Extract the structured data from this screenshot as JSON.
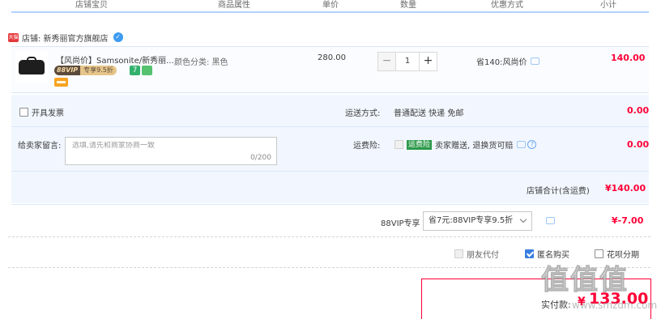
{
  "header": {
    "col_shop": "店铺宝贝",
    "col_props": "商品属性",
    "col_price": "单价",
    "col_qty": "数量",
    "col_discount": "优惠方式",
    "col_subtotal": "小计"
  },
  "shop": {
    "logo_text": "天猫",
    "label": "店铺: 新秀丽官方旗舰店"
  },
  "item": {
    "title": "【风尚价】Samsonite/新秀丽...",
    "tag_vip_a": "88VIP",
    "tag_vip_b": "专享9.5折",
    "tag_num": "7",
    "props": "颜色分类: 黑色",
    "price": "280.00",
    "qty_minus": "−",
    "qty_value": "1",
    "qty_plus": "+",
    "discount": "省140:风尚价",
    "subtotal": "140.00"
  },
  "options": {
    "invoice_label": "开具发票",
    "shipping_label": "运送方式:",
    "shipping_value": "普通配送 快递 免邮",
    "shipping_fee": "0.00",
    "message_label": "给卖家留言:",
    "message_placeholder": "选填,请先和商家协商一致",
    "message_counter": "0/200",
    "insurance_label": "运费险:",
    "insurance_tag": "运费险",
    "insurance_text": "卖家赠送, 退换货可赔",
    "insurance_help": "?",
    "insurance_fee": "0.00",
    "shop_total_label": "店铺合计(含运费)",
    "shop_total_value": "¥140.00"
  },
  "vip": {
    "label": "88VIP专享",
    "select_value": "省7元:88VIP专享9.5折",
    "fee": "¥-7.00"
  },
  "checks": {
    "friend_pay": "朋友代付",
    "anonymous": "匿名购买",
    "huabei": "花呗分期"
  },
  "final": {
    "label": "实付款:",
    "currency": "¥",
    "value": "133.00"
  },
  "watermark": {
    "glyphs": "值值值",
    "site": "www.smzdm.com"
  },
  "colors": {
    "accent_red": "#ff0036",
    "header_line": "#b2d1ff",
    "panel_bg": "#f2f7ff"
  }
}
